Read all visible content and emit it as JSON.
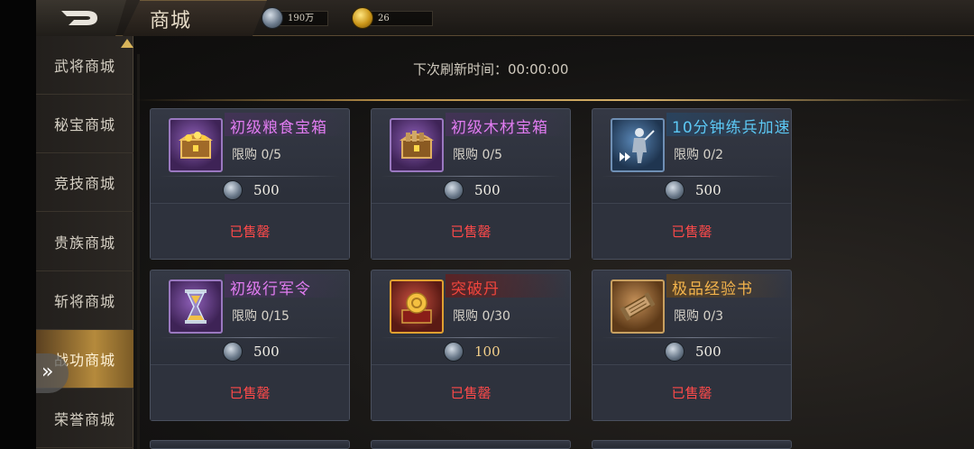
{
  "header": {
    "title": "商城",
    "silver_amount": "190万",
    "gold_amount": "26"
  },
  "sidebar": {
    "items": [
      {
        "label": "武将商城"
      },
      {
        "label": "秘宝商城"
      },
      {
        "label": "竞技商城"
      },
      {
        "label": "贵族商城"
      },
      {
        "label": "斩将商城"
      },
      {
        "label": "战功商城"
      },
      {
        "label": "荣誉商城"
      }
    ],
    "active_index": 5
  },
  "shop": {
    "refresh_text": "下次刷新时间：00:00:00",
    "items": [
      {
        "name": "初级粮食宝箱",
        "limit": "限购 0/5",
        "price": "500",
        "status": "已售罄",
        "icon": "treasure-chest-icon",
        "rarity": "purple"
      },
      {
        "name": "初级木材宝箱",
        "limit": "限购 0/5",
        "price": "500",
        "status": "已售罄",
        "icon": "treasure-chest-icon",
        "rarity": "purple"
      },
      {
        "name": "10分钟练兵加速",
        "limit": "限购 0/2",
        "price": "500",
        "status": "已售罄",
        "icon": "soldier-speedup-icon",
        "rarity": "blue"
      },
      {
        "name": "初级行军令",
        "limit": "限购 0/15",
        "price": "500",
        "status": "已售罄",
        "icon": "hourglass-icon",
        "rarity": "purple"
      },
      {
        "name": "突破丹",
        "limit": "限购 0/30",
        "price": "100",
        "status": "已售罄",
        "icon": "breakthrough-pill-icon",
        "rarity": "red"
      },
      {
        "name": "极品经验书",
        "limit": "限购 0/3",
        "price": "500",
        "status": "已售罄",
        "icon": "exp-book-icon",
        "rarity": "orange"
      }
    ]
  },
  "colors": {
    "purple": "#e07cf0",
    "blue": "#5cc8f4",
    "red": "#f0453c",
    "orange": "#f4b44c",
    "sold_out": "#ff4a4a"
  }
}
